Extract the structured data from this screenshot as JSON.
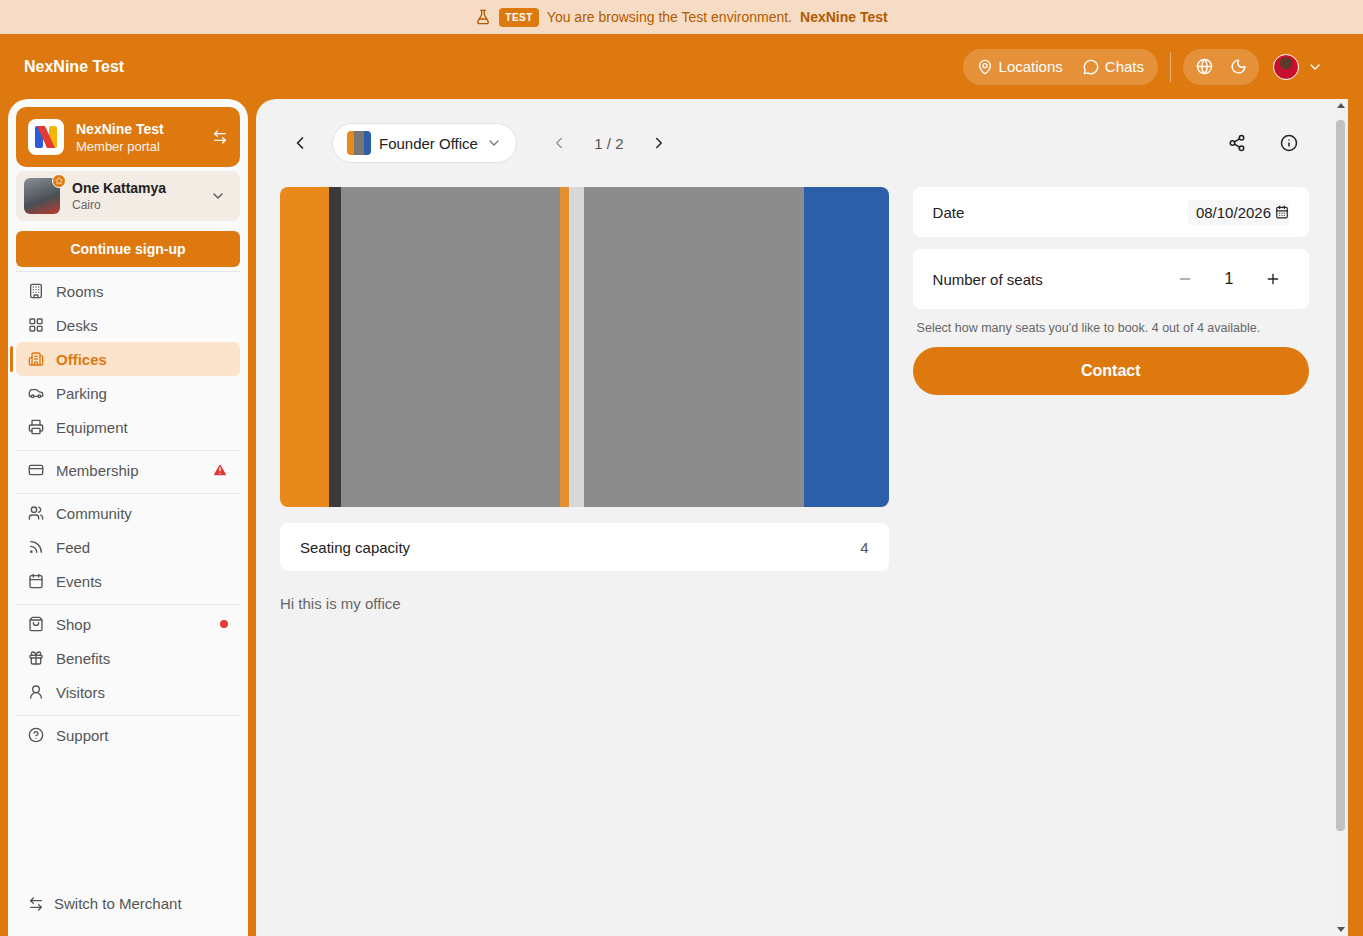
{
  "banner": {
    "badge": "TEST",
    "text": "You are browsing the Test environment.",
    "environment": "NexNine Test"
  },
  "header": {
    "brand": "NexNine Test",
    "nav": [
      {
        "label": "Locations"
      },
      {
        "label": "Chats"
      }
    ]
  },
  "sidebar": {
    "org": {
      "name": "NexNine Test",
      "subtitle": "Member portal"
    },
    "location": {
      "name": "One Kattamya",
      "city": "Cairo"
    },
    "cta": "Continue sign-up",
    "groups": [
      {
        "items": [
          {
            "label": "Rooms",
            "selected": false,
            "marker": "none"
          },
          {
            "label": "Desks",
            "selected": false,
            "marker": "none"
          },
          {
            "label": "Offices",
            "selected": true,
            "marker": "none"
          },
          {
            "label": "Parking",
            "selected": false,
            "marker": "none"
          },
          {
            "label": "Equipment",
            "selected": false,
            "marker": "none"
          }
        ]
      },
      {
        "items": [
          {
            "label": "Membership",
            "selected": false,
            "marker": "warning"
          }
        ]
      },
      {
        "items": [
          {
            "label": "Community",
            "selected": false,
            "marker": "none"
          },
          {
            "label": "Feed",
            "selected": false,
            "marker": "none"
          },
          {
            "label": "Events",
            "selected": false,
            "marker": "none"
          }
        ]
      },
      {
        "items": [
          {
            "label": "Shop",
            "selected": false,
            "marker": "dot"
          },
          {
            "label": "Benefits",
            "selected": false,
            "marker": "none"
          },
          {
            "label": "Visitors",
            "selected": false,
            "marker": "none"
          }
        ]
      },
      {
        "items": [
          {
            "label": "Support",
            "selected": false,
            "marker": "none"
          }
        ]
      }
    ],
    "footer": "Switch to Merchant"
  },
  "toolbar": {
    "office": "Founder Office",
    "pager": "1 / 2",
    "prev_disabled": true,
    "next_disabled": false
  },
  "details": {
    "capacity_label": "Seating capacity",
    "capacity": "4",
    "description": "Hi this is my office"
  },
  "booking": {
    "date_label": "Date",
    "date": "08/10/2026",
    "seats_label": "Number of seats",
    "seats": "1",
    "decrement_disabled": true,
    "increment_disabled": false,
    "hint": "Select how many seats you'd like to book. 4 out of 4 available.",
    "button": "Contact"
  }
}
